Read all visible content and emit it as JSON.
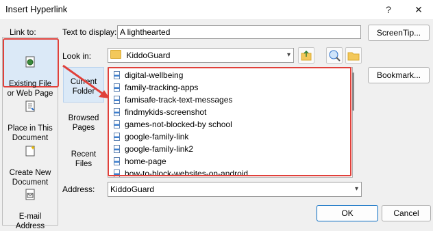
{
  "window": {
    "title": "Insert Hyperlink",
    "help_glyph": "?",
    "close_glyph": "✕"
  },
  "link_to": {
    "label": "Link to:",
    "items": [
      {
        "label": "Existing File\nor Web Page",
        "icon": "web-file-icon"
      },
      {
        "label": "Place in This\nDocument",
        "icon": "document-place-icon"
      },
      {
        "label": "Create New\nDocument",
        "icon": "new-document-icon"
      },
      {
        "label": "E-mail\nAddress",
        "icon": "email-icon"
      }
    ]
  },
  "text_to_display": {
    "label": "Text to display:",
    "value": "A lighthearted"
  },
  "screentip_button": "ScreenTip...",
  "look_in": {
    "label": "Look in:",
    "value": "KiddoGuard"
  },
  "browse": {
    "items": [
      "Current\nFolder",
      "Browsed\nPages",
      "Recent\nFiles"
    ]
  },
  "files": [
    "digital-wellbeing",
    "family-tracking-apps",
    "famisafe-track-text-messages",
    "findmykids-screenshot",
    "games-not-blocked-by school",
    "google-family-link",
    "google-family-link2",
    "home-page",
    "how-to-block-websites-on-android"
  ],
  "bookmark_button": "Bookmark...",
  "address": {
    "label": "Address:",
    "value": "KiddoGuard"
  },
  "ok_button": "OK",
  "cancel_button": "Cancel",
  "colors": {
    "highlight_red": "#e0403a",
    "selection_blue": "#dbe9f7"
  }
}
